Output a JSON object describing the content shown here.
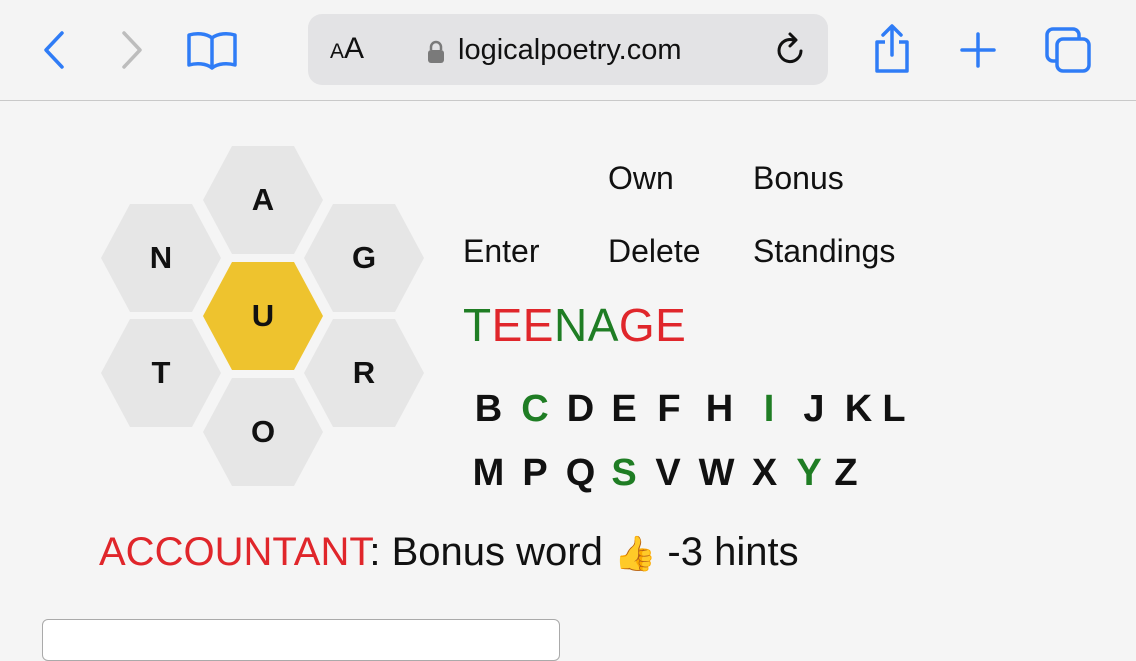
{
  "browser": {
    "url": "logicalpoetry.com",
    "reader_label_small": "A",
    "reader_label_large": "A",
    "icons": [
      "back-icon",
      "forward-icon",
      "bookmarks-icon",
      "lock-icon",
      "reload-icon",
      "share-icon",
      "new-tab-icon",
      "tabs-icon"
    ]
  },
  "puzzle": {
    "center_letter": "U",
    "outer_letters": {
      "top": "A",
      "upper_left": "N",
      "upper_right": "G",
      "lower_left": "T",
      "lower_right": "R",
      "bottom": "O"
    },
    "center_color": "#eec32e",
    "outer_color": "#e6e6e6"
  },
  "actions": {
    "own": "Own",
    "bonus": "Bonus",
    "enter": "Enter",
    "delete": "Delete",
    "standings": "Standings"
  },
  "current_word": {
    "segments": [
      {
        "text": "T",
        "color": "#1f7d24"
      },
      {
        "text": "EE",
        "color": "#e0262b"
      },
      {
        "text": "NA",
        "color": "#1f7d24"
      },
      {
        "text": "GE",
        "color": "#e0262b"
      }
    ]
  },
  "letters": {
    "row1": [
      {
        "l": "B",
        "c": "#111111"
      },
      {
        "l": "C",
        "c": "#1f7d24"
      },
      {
        "l": "D",
        "c": "#111111"
      },
      {
        "l": "E",
        "c": "#111111"
      },
      {
        "l": "F",
        "c": "#111111"
      },
      {
        "l": "H",
        "c": "#111111"
      },
      {
        "l": "I",
        "c": "#1f7d24"
      },
      {
        "l": "J",
        "c": "#111111"
      },
      {
        "l": "K",
        "c": "#111111"
      },
      {
        "l": "L",
        "c": "#111111"
      }
    ],
    "row2": [
      {
        "l": "M",
        "c": "#111111"
      },
      {
        "l": "P",
        "c": "#111111"
      },
      {
        "l": "Q",
        "c": "#111111"
      },
      {
        "l": "S",
        "c": "#1f7d24"
      },
      {
        "l": "V",
        "c": "#111111"
      },
      {
        "l": "W",
        "c": "#111111"
      },
      {
        "l": "X",
        "c": "#111111"
      },
      {
        "l": "Y",
        "c": "#1f7d24"
      },
      {
        "l": "Z",
        "c": "#111111"
      }
    ]
  },
  "message": {
    "word": "ACCOUNTANT",
    "word_color": "#e0262b",
    "text": ": Bonus word ",
    "emoji": "👍",
    "suffix": " -3 hints"
  }
}
